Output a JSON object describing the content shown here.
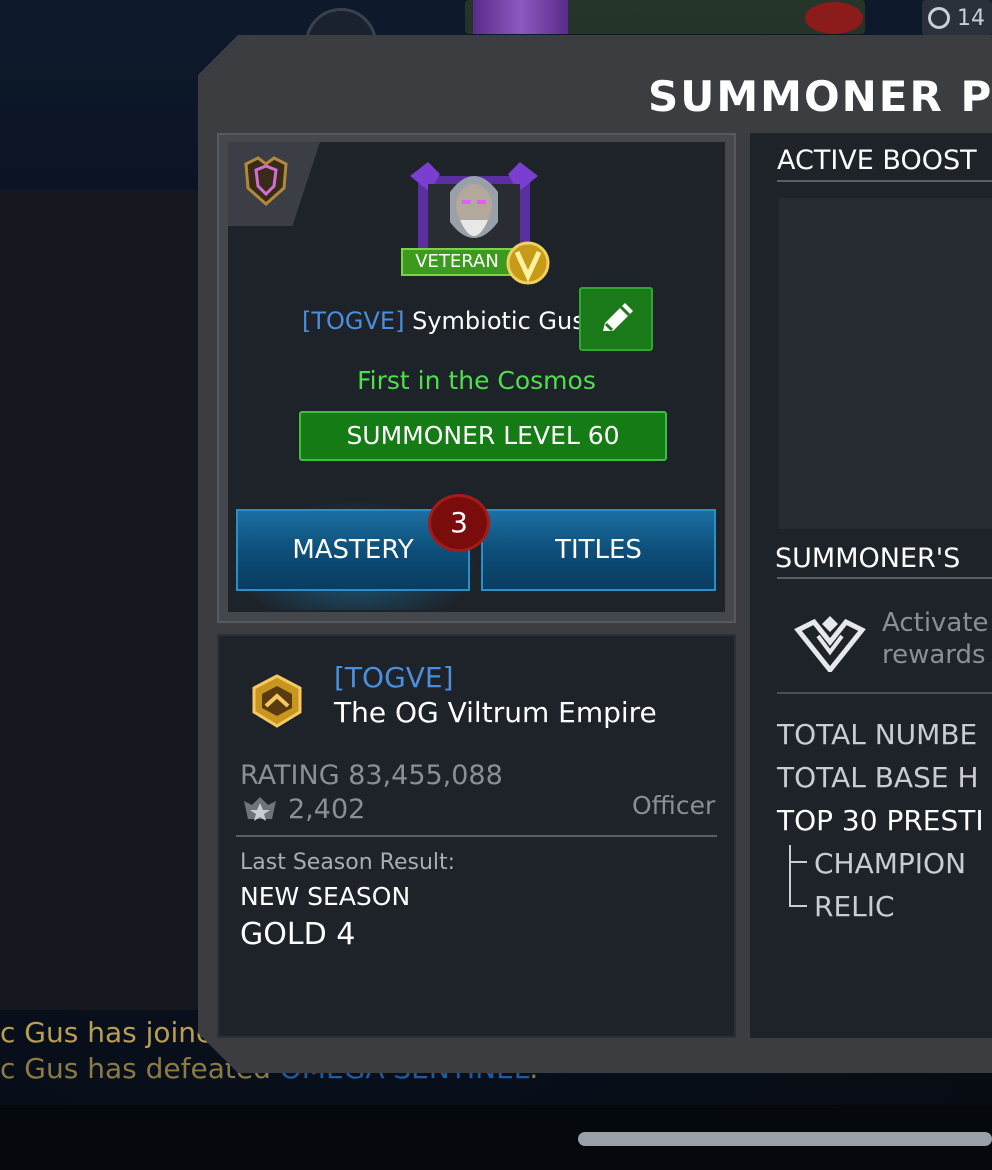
{
  "background": {
    "timer_text": "14",
    "chat_lines": [
      {
        "prefix": "c Gus has joine",
        "suffix": ""
      },
      {
        "prefix": "c Gus has defeated ",
        "highlight": "OMEGA SENTINEL",
        "suffix": "."
      }
    ]
  },
  "panel": {
    "title": "SUMMONER P"
  },
  "profile": {
    "badge_label": "VETERAN",
    "alliance_tag": "[TOGVE]",
    "player_name": "Symbiotic Gus",
    "title": "First in the Cosmos",
    "level_label": "SUMMONER LEVEL 60",
    "tabs": [
      {
        "label": "MASTERY",
        "notification_count": "3"
      },
      {
        "label": "TITLES"
      }
    ]
  },
  "alliance": {
    "tag": "[TOGVE]",
    "name": "The OG Viltrum Empire",
    "rating_label": "RATING 83,455,088",
    "trophies": "2,402",
    "role": "Officer",
    "last_season_label": "Last Season Result:",
    "last_season_value": "NEW SEASON",
    "last_season_rank": "GOLD 4"
  },
  "right_column": {
    "active_boosts_heading": "ACTIVE BOOST",
    "summoners_heading": "SUMMONER'S",
    "activate_text_line1": "Activate",
    "activate_text_line2": "rewards",
    "stats": [
      {
        "label": "TOTAL NUMBE"
      },
      {
        "label": "TOTAL BASE H"
      },
      {
        "label": "TOP 30 PRESTI"
      }
    ],
    "sub_stats": [
      {
        "label": "CHAMPION"
      },
      {
        "label": "RELIC"
      }
    ]
  },
  "colors": {
    "alliance_tag": "#4a8fdc",
    "title_green": "#4ee04a",
    "level_green": "#157c15",
    "tab_blue": "#1c6fa3",
    "badge_red": "#7a0c0c"
  }
}
